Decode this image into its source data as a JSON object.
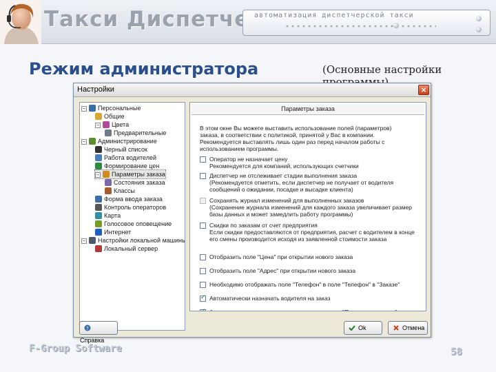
{
  "banner": {
    "brand": "Такси Диспетчер",
    "tagline": "автоматизация диспетчерской такси"
  },
  "page": {
    "title": "Режим администратора",
    "subtitle": "(Основные настройки программы)"
  },
  "window": {
    "title": "Настройки",
    "close_label": "×",
    "tree": [
      {
        "label": "Персональные",
        "toggle": "−",
        "icon": "person-icon",
        "color": "#3a6ea5"
      },
      {
        "label": "Общие",
        "icon": "folder-icon",
        "color": "#d9a531"
      },
      {
        "label": "Цвета",
        "toggle": "−",
        "icon": "palette-icon",
        "color": "#b04a9a"
      },
      {
        "label": "Предварительные",
        "icon": "document-icon",
        "color": "#6d7a88"
      },
      {
        "label": "Администрирование",
        "toggle": "−",
        "icon": "gears-icon",
        "color": "#5b8f2a"
      },
      {
        "label": "Черный список",
        "icon": "blacklist-icon",
        "color": "#333333"
      },
      {
        "label": "Работа водителей",
        "icon": "driver-icon",
        "color": "#4c7db8"
      },
      {
        "label": "Формирование цен",
        "icon": "price-icon",
        "color": "#2d8a3e"
      },
      {
        "label": "Параметры заказа",
        "toggle": "−",
        "icon": "order-icon",
        "color": "#d08a1c"
      },
      {
        "label": "Состояния заказа",
        "icon": "status-icon",
        "color": "#7a6aa8"
      },
      {
        "label": "Классы",
        "icon": "class-icon",
        "color": "#a55d2f"
      },
      {
        "label": "Форма ввода заказа",
        "icon": "form-icon",
        "color": "#3a6ea5"
      },
      {
        "label": "Контроль операторов",
        "icon": "operator-icon",
        "color": "#555555"
      },
      {
        "label": "Карта",
        "icon": "map-icon",
        "color": "#2f8fa5"
      },
      {
        "label": "Голосовое оповещение",
        "icon": "voice-icon",
        "color": "#7a9a2a"
      },
      {
        "label": "Интернет",
        "icon": "internet-icon",
        "color": "#1f5fbf"
      },
      {
        "label": "Настройки локальной машины",
        "toggle": "−",
        "icon": "computer-icon",
        "color": "#4a5a6a"
      },
      {
        "label": "Локальный сервер",
        "icon": "server-icon",
        "color": "#b03a3a"
      }
    ],
    "panel": {
      "header": "Параметры заказа",
      "description": "В этом окне Вы можете выставить использование полей (параметров) заказа, в соответствии с политикой, принятой у Вас в компании. Рекомендуется выставлять лишь один раз перед началом работы с использованием программы.",
      "options": [
        {
          "checked": false,
          "disabled": false,
          "text": "Оператор не назначает цену",
          "note": "Рекомендуется для компаний, использующих счетчики"
        },
        {
          "checked": false,
          "disabled": false,
          "text": "Диспетчер не отслеживает стадии выполнения заказа",
          "note": "(Рекомендуется отметить, если диспетчер не получает от водителя сообщений о ожидании, посадке и высадке клиента)"
        },
        {
          "checked": false,
          "disabled": true,
          "text": "Сохранять журнал изменений для выполненных заказов",
          "note": "(Сохранение журнала изменений для каждого заказа увеличивает размер базы данных и может замедлить работу программы)"
        },
        {
          "checked": false,
          "disabled": false,
          "text": "Скидки по заказам от счет предприятия",
          "note": "Если скидки предоставляются от предприятия, расчет с водителем в конце его смены производится исходя из заявленной стоимости заказа"
        },
        {
          "checked": false,
          "disabled": false,
          "text": "Отобразить поле \"Цена\" при открытии нового заказа",
          "note": ""
        },
        {
          "checked": false,
          "disabled": false,
          "text": "Отобразить поле \"Адрес\" при открытии нового заказа",
          "note": ""
        },
        {
          "checked": false,
          "disabled": false,
          "text": "Необходимо отображать поле \"Телефон\" в поле \"Телефон\" в \"Заказе\"",
          "note": ""
        },
        {
          "checked": true,
          "disabled": false,
          "text": "Автоматически назначать водителя на заказ",
          "note": ""
        },
        {
          "checked": true,
          "disabled": false,
          "text": "Автоматически устанавливать состояние заказа \"Позитивно выехал\"",
          "note": ""
        }
      ]
    },
    "buttons": {
      "help": "Справка",
      "ok": "Ok",
      "cancel": "Отмена"
    }
  },
  "footer": {
    "brand": "F-Group Software",
    "page_number": "58"
  },
  "colors": {
    "title": "#2b4e8c",
    "window_bg": "#ece9d8",
    "checkmark": "#1f7a1f"
  }
}
